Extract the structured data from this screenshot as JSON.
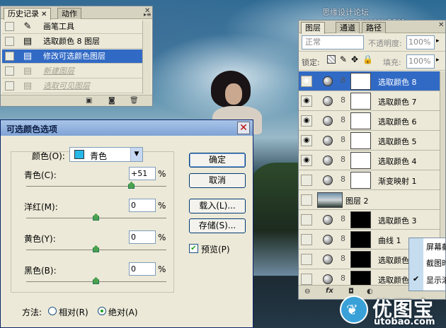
{
  "watermark": {
    "top": "思缘设计论坛 www.MISSYUAN.COM",
    "logo_text": "优图宝",
    "logo_domain": "utobao.com"
  },
  "history_panel": {
    "tabs": [
      "历史记录",
      "动作"
    ],
    "items": [
      {
        "label": "画笔工具",
        "state": "normal",
        "icon": "brush-icon"
      },
      {
        "label": "选取颜色 8 图层",
        "state": "normal",
        "icon": "document-icon"
      },
      {
        "label": "修改可选颜色图层",
        "state": "selected",
        "icon": "document-icon"
      },
      {
        "label": "新建图层",
        "state": "ghost",
        "icon": "document-icon"
      },
      {
        "label": "选取可见图层",
        "state": "ghost",
        "icon": "document-icon"
      }
    ]
  },
  "layers_panel": {
    "tabs": [
      "图层",
      "通道",
      "路径"
    ],
    "blend_mode": "正常",
    "opacity_label": "不透明度:",
    "opacity_value": "100%",
    "lock_label": "锁定:",
    "fill_label": "填充:",
    "fill_value": "100%",
    "layers": [
      {
        "name": "选取颜色 8",
        "visible": true,
        "selected": true,
        "mask": "white"
      },
      {
        "name": "选取颜色 7",
        "visible": true,
        "selected": false,
        "mask": "white"
      },
      {
        "name": "选取颜色 6",
        "visible": true,
        "selected": false,
        "mask": "white"
      },
      {
        "name": "选取颜色 5",
        "visible": true,
        "selected": false,
        "mask": "white"
      },
      {
        "name": "选取颜色 4",
        "visible": true,
        "selected": false,
        "mask": "white"
      },
      {
        "name": "渐变映射 1",
        "visible": false,
        "selected": false,
        "mask": "white"
      },
      {
        "name": "图层 2",
        "visible": false,
        "selected": false,
        "type": "image"
      },
      {
        "name": "选取颜色 3",
        "visible": false,
        "selected": false,
        "mask": "dark"
      },
      {
        "name": "曲线 1",
        "visible": false,
        "selected": false,
        "mask": "dark"
      },
      {
        "name": "选取颜色",
        "visible": false,
        "selected": false,
        "mask": "dark"
      },
      {
        "name": "选取颜色",
        "visible": false,
        "selected": false,
        "mask": "dark"
      }
    ]
  },
  "context_menu": {
    "items": [
      {
        "label": "屏幕截",
        "checked": false
      },
      {
        "label": "截图时",
        "checked": false
      },
      {
        "label": "显示滚",
        "checked": true
      }
    ]
  },
  "dialog": {
    "title": "可选颜色选项",
    "color_label": "颜色(O):",
    "color_value": "青色",
    "color_swatch": "#28b8e8",
    "sliders": [
      {
        "label": "青色(C):",
        "value": "+51",
        "fraction": 0.755
      },
      {
        "label": "洋红(M):",
        "value": "0",
        "fraction": 0.5
      },
      {
        "label": "黄色(Y):",
        "value": "0",
        "fraction": 0.5
      },
      {
        "label": "黑色(B):",
        "value": "0",
        "fraction": 0.5
      }
    ],
    "percent": "%",
    "buttons": {
      "ok": "确定",
      "cancel": "取消",
      "load": "载入(L)...",
      "save": "存储(S)..."
    },
    "preview_label": "预览(P)",
    "preview_checked": true,
    "method_label": "方法:",
    "method_relative": "相对(R)",
    "method_absolute": "绝对(A)",
    "method_selected": "absolute"
  }
}
